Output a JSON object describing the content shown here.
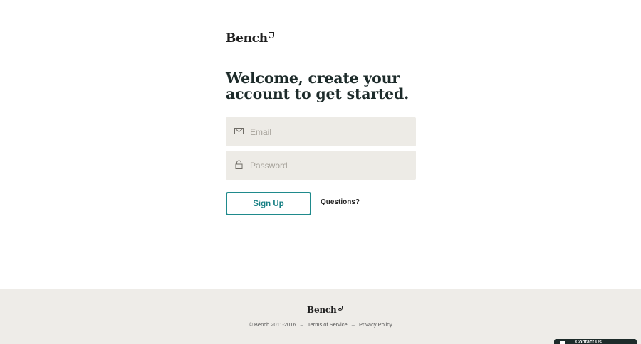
{
  "brand": {
    "logo_text": "Bench"
  },
  "main": {
    "headline": "Welcome, create your account to get started.",
    "email": {
      "placeholder": "Email",
      "value": "",
      "icon": "mail-icon"
    },
    "password": {
      "placeholder": "Password",
      "value": "",
      "icon": "lock-icon"
    },
    "signup_label": "Sign Up",
    "questions_label": "Questions?"
  },
  "footer": {
    "logo_text": "Bench",
    "copyright": "© Bench 2011-2016",
    "separator": "–",
    "terms_label": "Terms of Service",
    "privacy_label": "Privacy Policy"
  },
  "help_widget": {
    "label": "Contact Us"
  },
  "colors": {
    "accent": "#1f8a8c",
    "field_bg": "#edebe6",
    "footer_bg": "#eeece8",
    "heading": "#1d2b2a"
  }
}
